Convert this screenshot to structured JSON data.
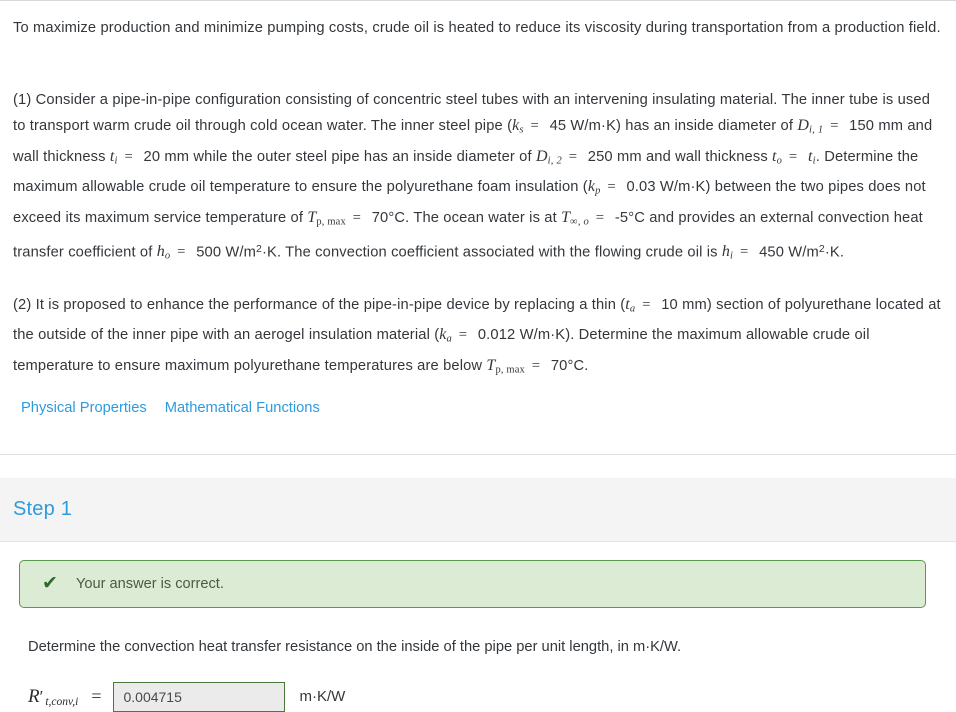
{
  "intro": {
    "paragraph": "To maximize production and minimize pumping costs, crude oil is heated to reduce its viscosity during transportation from a production field."
  },
  "part1": {
    "s1": "(1) Consider a pipe-in-pipe configuration consisting of concentric steel tubes with an intervening insulating material. The inner tube is used to transport warm crude oil through cold ocean water. The inner steel pipe (",
    "k_s": "k",
    "k_s_sub": "s",
    "k_s_val": "45 W/m·K",
    "s2": ") has an inside diameter of ",
    "D_i1": "D",
    "D_i1_sub": "i, 1",
    "D_i1_val": "150 mm",
    "s3": " and wall thickness ",
    "t_i": "t",
    "t_i_sub": "i",
    "t_i_val": "20 mm",
    "s4": " while the outer steel pipe has an inside diameter of ",
    "D_i2": "D",
    "D_i2_sub": "i, 2",
    "D_i2_val": "250 mm",
    "s5": " and wall thickness ",
    "t_o": "t",
    "t_o_sub": "o",
    "t_o_rhs": "t",
    "t_o_rhs_sub": "i",
    "s6": ". Determine the maximum allowable crude oil temperature to ensure the polyurethane foam insulation (",
    "k_p": "k",
    "k_p_sub": "p",
    "k_p_val": "0.03 W/m·K",
    "s7": ") between the two pipes does not exceed its maximum service temperature of ",
    "T_pmax": "T",
    "T_pmax_sub": "p, max",
    "T_pmax_val": "70°C",
    "s8": ". The ocean water is at ",
    "T_inf_o": "T",
    "T_inf_o_sub": "∞, o",
    "T_inf_o_val": "-5°C",
    "s9": " and provides an external convection heat transfer coefficient of ",
    "h_o": "h",
    "h_o_sub": "o",
    "h_o_val": "500 W/m",
    "h_o_val_end": "·K",
    "s10": ". The convection coefficient associated with the flowing crude oil is ",
    "h_i": "h",
    "h_i_sub": "i",
    "h_i_val": "450 W/m",
    "h_i_val_end": "·K",
    "s11": "."
  },
  "part2": {
    "s1": "(2) It is proposed to enhance the performance of the pipe-in-pipe device by replacing a thin (",
    "t_a": "t",
    "t_a_sub": "a",
    "t_a_val": "10 mm",
    "s2": ") section of polyurethane located at the outside of the inner pipe with an aerogel insulation material (",
    "k_a": "k",
    "k_a_sub": "a",
    "k_a_val": "0.012 W/m·K",
    "s3": "). Determine the maximum allowable crude oil temperature to ensure maximum polyurethane temperatures are below ",
    "T_pmax": "T",
    "T_pmax_sub": "p, max",
    "T_pmax_val": "70°C",
    "s4": "."
  },
  "links": [
    {
      "label": "Physical Properties",
      "name": "physical-properties-link"
    },
    {
      "label": "Mathematical Functions",
      "name": "mathematical-functions-link"
    }
  ],
  "step": {
    "title": "Step 1",
    "feedback": {
      "icon": "check-icon",
      "text": "Your answer is correct."
    },
    "prompt": "Determine the convection heat transfer resistance on the inside of the pipe per unit length, in m·K/W.",
    "answer": {
      "symbol": "R",
      "prime": "′",
      "subscript": "t,conv,i",
      "equals": "=",
      "value": "0.004715",
      "placeholder": "",
      "units": "m·K/W"
    }
  },
  "colors": {
    "link": "#2e9bdf",
    "step_title": "#2e9bdf",
    "success_bg": "#dcecd4",
    "success_border": "#5a9a4e",
    "success_check": "#2b6b2b",
    "input_border": "#4a7a3a",
    "input_bg": "#ebebeb",
    "text": "#33373b",
    "band_bg": "#f4f4f4"
  }
}
